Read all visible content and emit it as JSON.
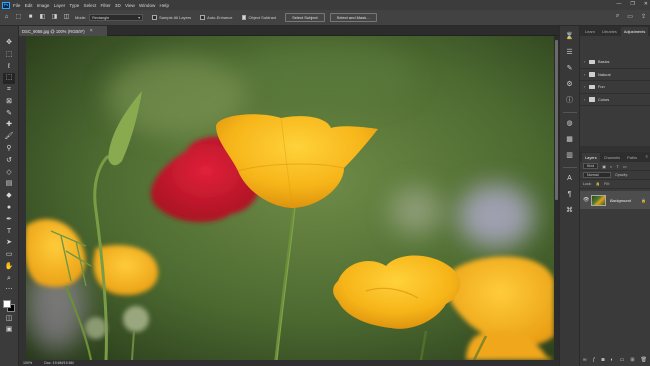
{
  "app": {
    "logo_text": "Ps"
  },
  "menu": {
    "items": [
      "File",
      "Edit",
      "Image",
      "Layer",
      "Type",
      "Select",
      "Filter",
      "3D",
      "View",
      "Window",
      "Help"
    ]
  },
  "window_controls": {
    "minimize": "—",
    "restore": "❐",
    "close": "✕"
  },
  "options": {
    "mode_label": "Mode:",
    "mode_value": "Rectangle",
    "sample_all_layers": "Sample All Layers",
    "auto_enhance": "Auto-Enhance",
    "object_subtract": "Object Subtract",
    "select_subject": "Select Subject",
    "select_and_mask": "Select and Mask..."
  },
  "document": {
    "tab_title": "DSC_9058.jpg @ 100% (RGB/8*)",
    "tab_close": "×",
    "zoom": "100%",
    "doc_info": "Doc: 19.6M/19.6M"
  },
  "libraries_panel": {
    "tabs": [
      "Learn",
      "Libraries",
      "Adjustments"
    ],
    "folders": [
      "Basics",
      "Natural",
      "Fun",
      "Colors"
    ]
  },
  "layers_panel": {
    "tabs": [
      "Layers",
      "Channels",
      "Paths"
    ],
    "kind_label": "Kind",
    "blend_mode": "Normal",
    "opacity_label": "Opacity:",
    "lock_label": "Lock:",
    "fill_label": "Fill:",
    "layer_name": "Background"
  },
  "colors": {
    "foreground": "#ffffff",
    "background": "#000000",
    "accent": "#31a8ff"
  }
}
